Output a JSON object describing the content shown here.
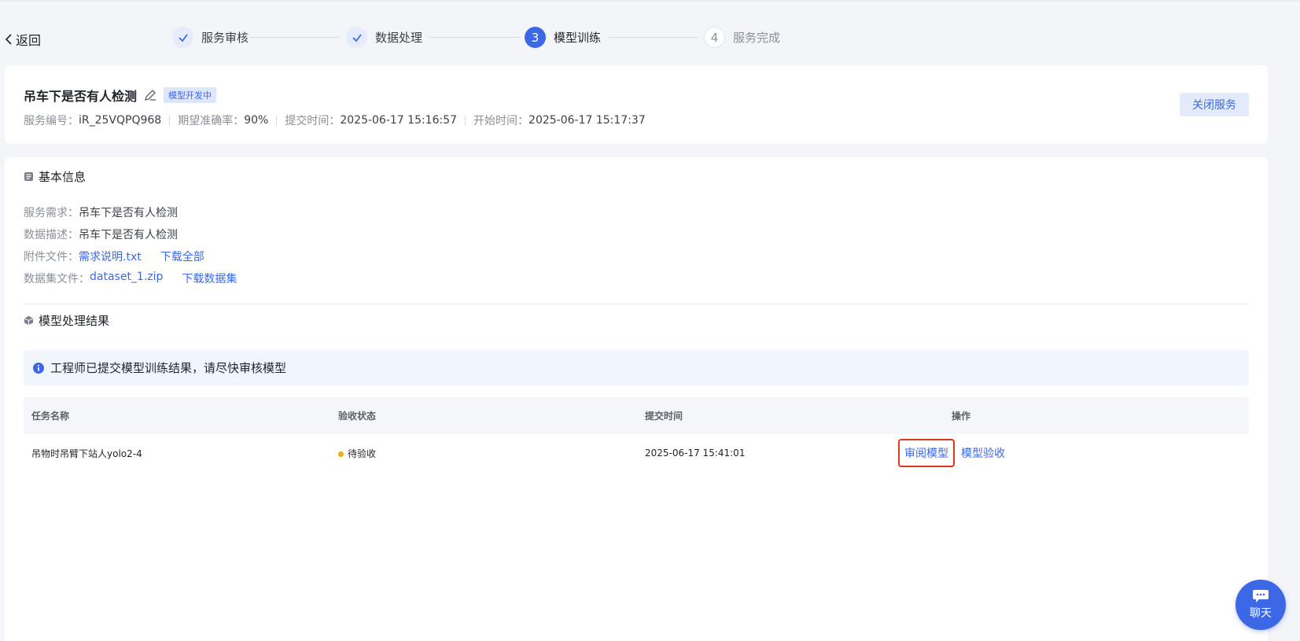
{
  "header": {
    "back_label": "返回",
    "steps": [
      {
        "label": "服务审核",
        "number": "",
        "state": "done"
      },
      {
        "label": "数据处理",
        "number": "",
        "state": "done"
      },
      {
        "label": "模型训练",
        "number": "3",
        "state": "active"
      },
      {
        "label": "服务完成",
        "number": "4",
        "state": "todo"
      }
    ]
  },
  "service": {
    "title": "吊车下是否有人检测",
    "status_tag": "模型开发中",
    "meta": [
      {
        "key": "服务编号：",
        "value": "iR_25VQPQ968"
      },
      {
        "key": "期望准确率：",
        "value": "90%"
      },
      {
        "key": "提交时间：",
        "value": "2025-06-17 15:16:57"
      },
      {
        "key": "开始时间：",
        "value": "2025-06-17 15:17:37"
      }
    ],
    "close_label": "关闭服务"
  },
  "basic_info": {
    "title": "基本信息",
    "requirement_key": "服务需求：",
    "requirement_value": "吊车下是否有人检测",
    "data_desc_key": "数据描述：",
    "data_desc_value": "吊车下是否有人检测",
    "attachment_key": "附件文件：",
    "attachment_file": "需求说明.txt",
    "attachment_download": "下载全部",
    "dataset_key": "数据集文件：",
    "dataset_file": "dataset_1.zip",
    "dataset_download": "下载数据集"
  },
  "results": {
    "title": "模型处理结果",
    "notice": "工程师已提交模型训练结果，请尽快审核模型",
    "columns": [
      "任务名称",
      "验收状态",
      "提交时间",
      "操作"
    ],
    "rows": [
      {
        "name": "吊物时吊臂下站人yolo2-4",
        "status": "待验收",
        "status_color": "#f5a623",
        "time": "2025-06-17 15:41:01",
        "action_review": "审阅模型",
        "action_accept": "模型验收"
      }
    ]
  },
  "chat": {
    "label": "聊天"
  },
  "colors": {
    "accent": "#3d68e5",
    "highlight_border": "#e0371f"
  }
}
